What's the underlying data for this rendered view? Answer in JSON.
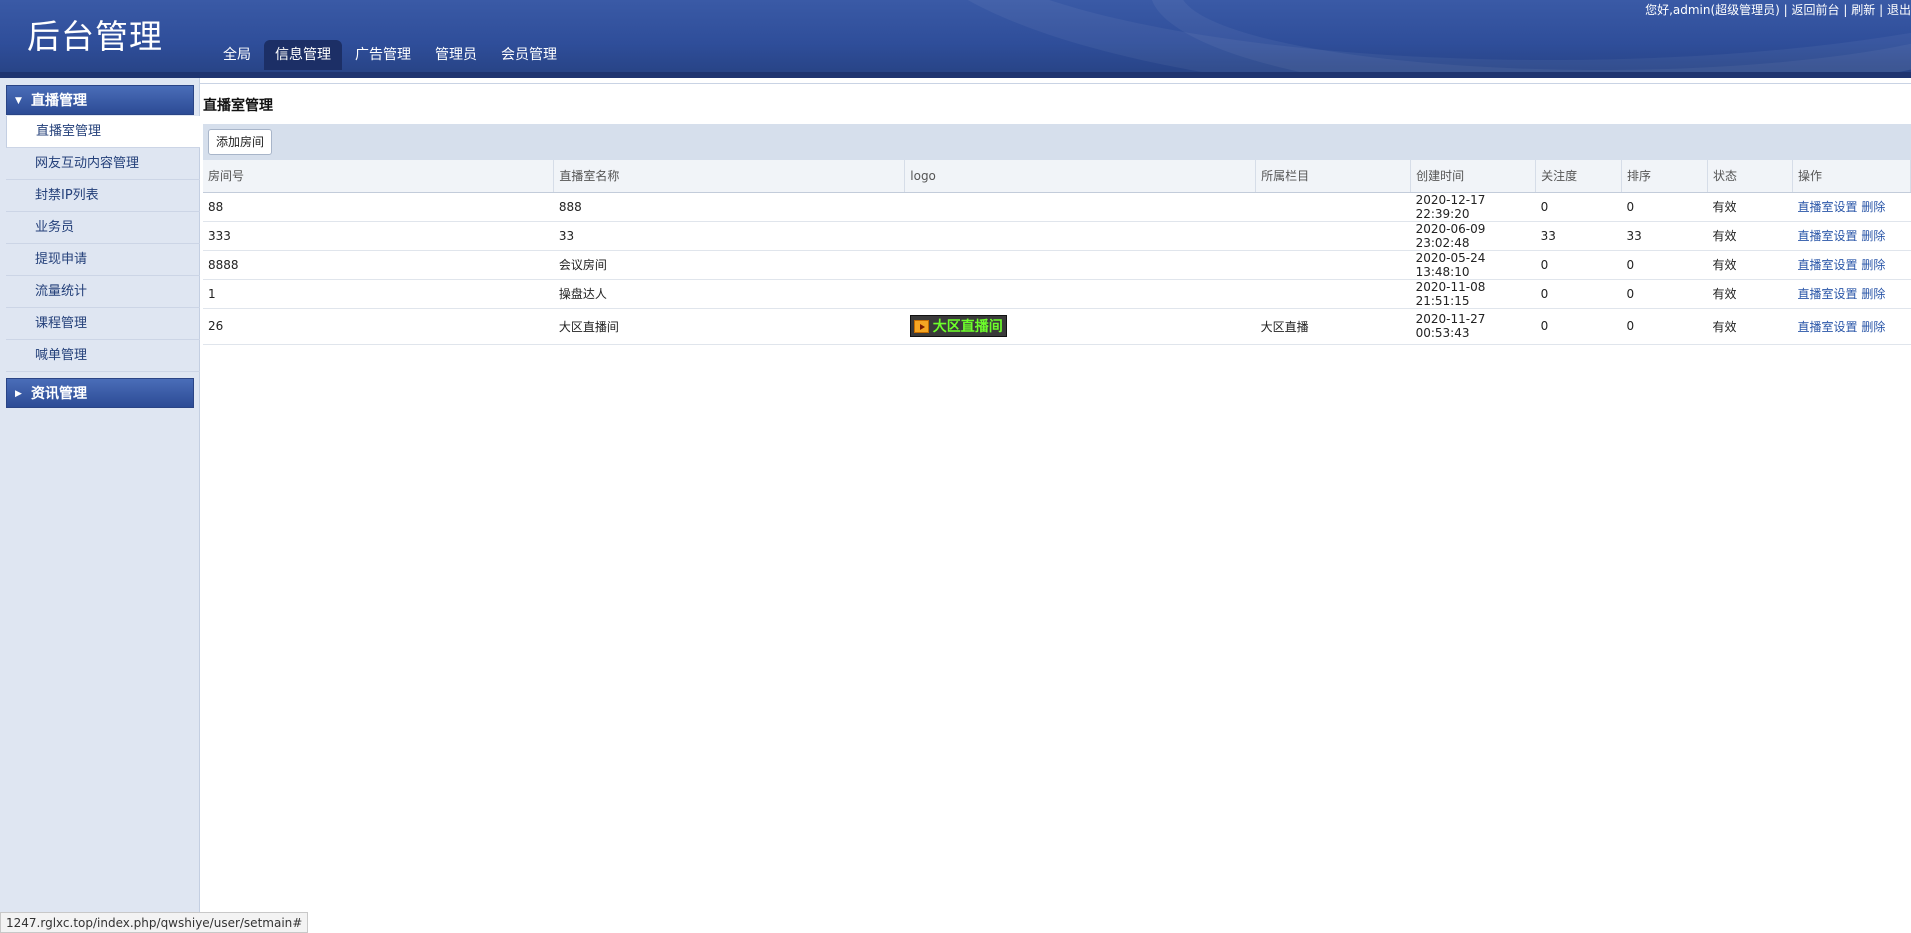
{
  "header": {
    "title": "后台管理",
    "nav": [
      "全局",
      "信息管理",
      "广告管理",
      "管理员",
      "会员管理"
    ],
    "active_nav": "信息管理",
    "user_greeting": "您好,admin(超级管理员)",
    "sep": "|",
    "links": [
      "返回前台",
      "刷新",
      "退出"
    ]
  },
  "sidebar": {
    "group1": {
      "label": "直播管理",
      "expanded": true
    },
    "items": [
      "直播室管理",
      "网友互动内容管理",
      "封禁IP列表",
      "业务员",
      "提现申请",
      "流量统计",
      "课程管理",
      "喊单管理"
    ],
    "active_item": "直播室管理",
    "group2": {
      "label": "资讯管理",
      "expanded": false
    }
  },
  "main": {
    "page_title": "直播室管理",
    "add_button": "添加房间",
    "columns": [
      "房间号",
      "直播室名称",
      "logo",
      "所属栏目",
      "创建时间",
      "关注度",
      "排序",
      "状态",
      "操作"
    ],
    "rows": [
      {
        "room_no": "88",
        "name": "888",
        "logo": "",
        "category": "",
        "created": "2020-12-17 22:39:20",
        "follow": "0",
        "sort": "0",
        "status": "有效"
      },
      {
        "room_no": "333",
        "name": "33",
        "logo": "",
        "category": "",
        "created": "2020-06-09 23:02:48",
        "follow": "33",
        "sort": "33",
        "status": "有效"
      },
      {
        "room_no": "8888",
        "name": "会议房间",
        "logo": "",
        "category": "",
        "created": "2020-05-24 13:48:10",
        "follow": "0",
        "sort": "0",
        "status": "有效"
      },
      {
        "room_no": "1",
        "name": "操盘达人",
        "logo": "",
        "category": "",
        "created": "2020-11-08 21:51:15",
        "follow": "0",
        "sort": "0",
        "status": "有效"
      },
      {
        "room_no": "26",
        "name": "大区直播间",
        "logo": "大区直播间",
        "category": "大区直播",
        "created": "2020-11-27 00:53:43",
        "follow": "0",
        "sort": "0",
        "status": "有效"
      }
    ],
    "action_settings": "直播室设置",
    "action_delete": "删除"
  },
  "statusbar": {
    "url": "1247.rglxc.top/index.php/qwshiye/user/setmain#"
  },
  "colors": {
    "header": "#2f4e9a",
    "sidebar_bg": "#dfe6f2",
    "link": "#2a56a8",
    "logo_text": "#6cff2a"
  }
}
